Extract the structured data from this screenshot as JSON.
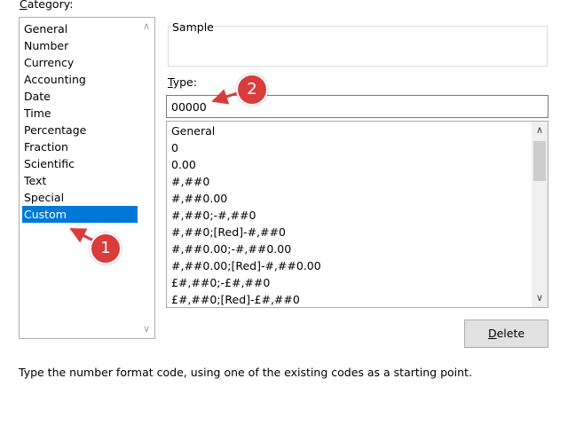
{
  "category": {
    "label": "Category:",
    "items": [
      "General",
      "Number",
      "Currency",
      "Accounting",
      "Date",
      "Time",
      "Percentage",
      "Fraction",
      "Scientific",
      "Text",
      "Special",
      "Custom"
    ],
    "selected": "Custom"
  },
  "sample": {
    "label": "Sample"
  },
  "type": {
    "label": "Type:",
    "value": "00000",
    "formats": [
      "General",
      "0",
      "0.00",
      "#,##0",
      "#,##0.00",
      "#,##0;-#,##0",
      "#,##0;[Red]-#,##0",
      "#,##0.00;-#,##0.00",
      "#,##0.00;[Red]-#,##0.00",
      "£#,##0;-£#,##0",
      "£#,##0;[Red]-£#,##0"
    ]
  },
  "buttons": {
    "delete": "Delete"
  },
  "hint": "Type the number format code, using one of the existing codes as a starting point.",
  "annotations": {
    "badge1": "1",
    "badge2": "2",
    "color": "#d93c3c"
  },
  "colors": {
    "selection": "#0078d7"
  }
}
